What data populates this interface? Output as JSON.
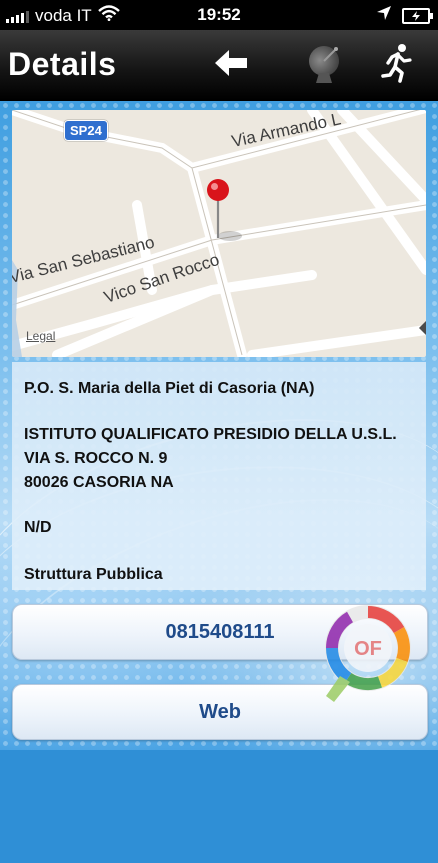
{
  "status_bar": {
    "carrier": "voda IT",
    "time": "19:52",
    "icons": [
      "signal-bars-icon",
      "wifi-icon",
      "location-arrow-icon",
      "battery-charging-icon"
    ]
  },
  "nav_bar": {
    "title": "Details",
    "icons": [
      "back-arrow-icon",
      "radar-dish-icon",
      "running-man-icon"
    ]
  },
  "map": {
    "road_labels": [
      "Via Armando L",
      "Via San Sebastiano",
      "Vico San Rocco"
    ],
    "route_shield": "SP24",
    "legal_label": "Legal",
    "icons": [
      "map-pin-icon",
      "tag-icon"
    ]
  },
  "details": {
    "name": "P.O. S. Maria della Piet  di Casoria (NA)",
    "address_lines": [
      "ISTITUTO QUALIFICATO PRESIDIO DELLA U.S.L.",
      "VIA S. ROCCO N. 9",
      "80026 CASORIA NA"
    ],
    "notes": "N/D",
    "type": "Struttura Pubblica"
  },
  "buttons": {
    "phone": "0815408111",
    "web": "Web"
  },
  "logo": {
    "text": "OF"
  },
  "colors": {
    "button_text": "#1f4b8a",
    "background_blue": "#2f8fd6",
    "pin_red": "#d9141b"
  }
}
